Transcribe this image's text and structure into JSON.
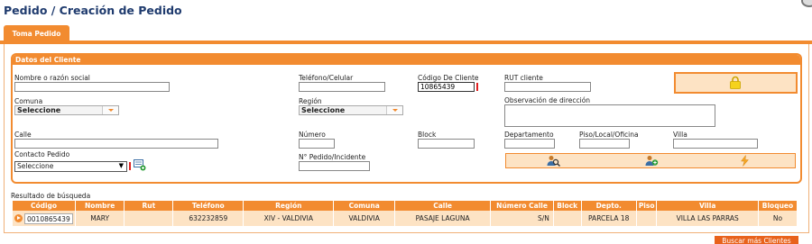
{
  "page": {
    "title": "Pedido / Creación de Pedido"
  },
  "tabs": [
    {
      "label": "Toma Pedido"
    }
  ],
  "client_panel": {
    "header": "Datos del Cliente",
    "fields": {
      "nombre": {
        "label": "Nombre o razón social",
        "value": ""
      },
      "telefono": {
        "label": "Teléfono/Celular",
        "value": ""
      },
      "codigo_cliente": {
        "label": "Código De Cliente",
        "value": "10865439"
      },
      "rut": {
        "label": "RUT cliente",
        "value": ""
      },
      "comuna": {
        "label": "Comuna",
        "value": "Seleccione"
      },
      "region": {
        "label": "Región",
        "value": "Seleccione"
      },
      "observacion": {
        "label": "Observación de dirección",
        "value": ""
      },
      "calle": {
        "label": "Calle",
        "value": ""
      },
      "numero": {
        "label": "Número",
        "value": ""
      },
      "block": {
        "label": "Block",
        "value": ""
      },
      "departamento": {
        "label": "Departamento",
        "value": ""
      },
      "piso": {
        "label": "Piso/Local/Oficina",
        "value": ""
      },
      "villa": {
        "label": "Villa",
        "value": ""
      },
      "contacto": {
        "label": "Contacto Pedido",
        "value": "Seleccione"
      },
      "pedido_incidente": {
        "label": "N° Pedido/Incidente",
        "value": ""
      }
    },
    "icons": {
      "lock": "lock-icon",
      "add_contact": "add-contact-icon",
      "search_user": "search-user-icon",
      "add_user": "add-user-icon",
      "lightning": "lightning-icon"
    }
  },
  "results": {
    "title": "Resultado de búsqueda",
    "columns": [
      "Código",
      "Nombre",
      "Rut",
      "Teléfono",
      "Región",
      "Comuna",
      "Calle",
      "Número Calle",
      "Block",
      "Depto.",
      "Piso",
      "Villa",
      "Bloqueo"
    ],
    "rows": [
      [
        "0010865439",
        "MARY",
        "",
        "632232859",
        "XIV - VALDIVIA",
        "VALDIVIA",
        "PASAJE LAGUNA",
        "S/N",
        "",
        "PARCELA 18",
        "",
        "VILLA LAS PARRAS",
        "No"
      ]
    ],
    "more_button": "Buscar más Clientes"
  },
  "colors": {
    "accent": "#f28b30",
    "accent_light": "#fde3c4",
    "title": "#1f3b6e",
    "required": "#e02020"
  }
}
